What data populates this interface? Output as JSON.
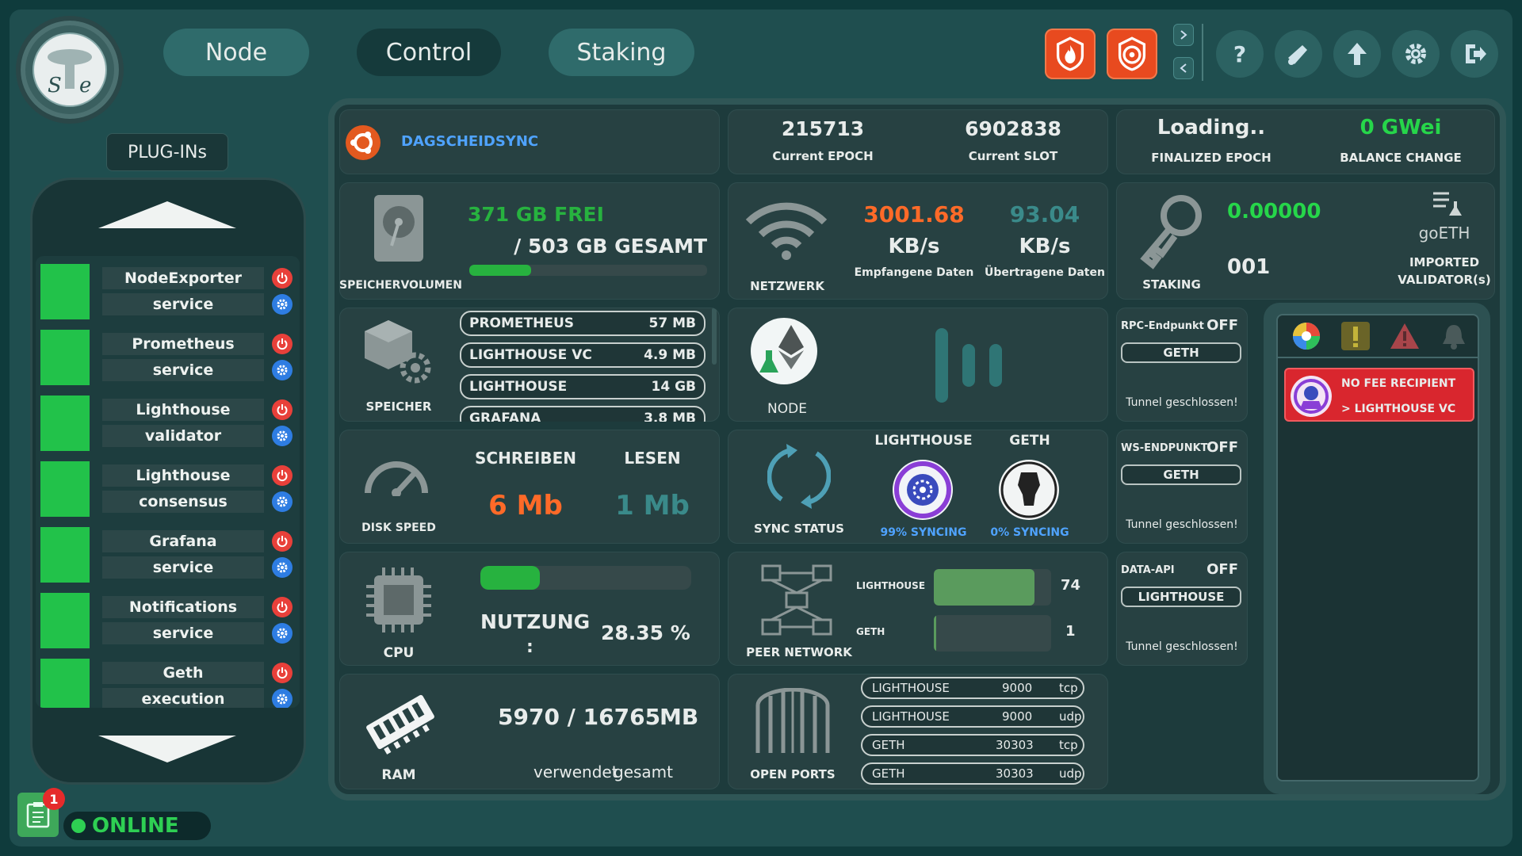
{
  "nav": {
    "tabs": [
      {
        "label": "Node"
      },
      {
        "label": "Control"
      },
      {
        "label": "Staking"
      }
    ]
  },
  "sidebar": {
    "title": "PLUG-INs",
    "plugins": [
      {
        "name": "NodeExporter",
        "type": "service"
      },
      {
        "name": "Prometheus",
        "type": "service"
      },
      {
        "name": "Lighthouse",
        "type": "validator"
      },
      {
        "name": "Lighthouse",
        "type": "consensus"
      },
      {
        "name": "Grafana",
        "type": "service"
      },
      {
        "name": "Notifications",
        "type": "service"
      },
      {
        "name": "Geth",
        "type": "execution"
      }
    ]
  },
  "status": {
    "online_label": "ONLINE",
    "notification_count": "1"
  },
  "header": {
    "node_name": "DAGSCHEIDSYNC",
    "epoch_value": "215713",
    "epoch_label": "Current EPOCH",
    "slot_value": "6902838",
    "slot_label": "Current SLOT",
    "finalized_value": "Loading..",
    "finalized_label": "FINALIZED EPOCH",
    "balance_value": "0 GWei",
    "balance_label": "BALANCE CHANGE"
  },
  "storage_volume": {
    "free": "371 GB FREI",
    "total": "/ 503 GB GESAMT",
    "label": "SPEICHERVOLUMEN",
    "used_fraction": 0.26
  },
  "network": {
    "label": "NETZWERK",
    "received_value": "3001.68",
    "received_unit": "KB/s",
    "received_label": "Empfangene Daten",
    "sent_value": "93.04",
    "sent_unit": "KB/s",
    "sent_label": "Übertragene Daten"
  },
  "staking": {
    "label": "STAKING",
    "balance": "0.00000",
    "currency": "goETH",
    "validators": "001",
    "validators_label_1": "IMPORTED",
    "validators_label_2": "VALIDATOR(s)"
  },
  "storage": {
    "label": "SPEICHER",
    "items": [
      {
        "name": "PROMETHEUS",
        "size": "57 MB"
      },
      {
        "name": "LIGHTHOUSE VC",
        "size": "4.9 MB"
      },
      {
        "name": "LIGHTHOUSE",
        "size": "14 GB"
      },
      {
        "name": "GRAFANA",
        "size": "3.8 MB"
      }
    ]
  },
  "node": {
    "label": "NODE"
  },
  "disk_speed": {
    "label": "DISK SPEED",
    "write_label": "SCHREIBEN",
    "write_value": "6 Mb",
    "read_label": "LESEN",
    "read_value": "1 Mb"
  },
  "sync": {
    "label": "SYNC STATUS",
    "client1_name": "LIGHTHOUSE",
    "client1_status": "99% SYNCING",
    "client2_name": "GETH",
    "client2_status": "0% SYNCING"
  },
  "cpu": {
    "label": "CPU",
    "usage_label": "NUTZUNG",
    "colon": ":",
    "usage_value": "28.35 %",
    "usage_fraction": 0.2835
  },
  "peers": {
    "label": "PEER NETWORK",
    "client1_name": "LIGHTHOUSE",
    "client1_count": "74",
    "client1_fraction": 0.86,
    "client2_name": "GETH",
    "client2_count": "1",
    "client2_fraction": 0.02
  },
  "ram": {
    "label": "RAM",
    "value": "5970 / 16765",
    "unit": "MB",
    "used_label": "verwendet",
    "total_label": "gesamt"
  },
  "ports": {
    "label": "OPEN PORTS",
    "items": [
      {
        "client": "LIGHTHOUSE",
        "port": "9000",
        "proto": "tcp"
      },
      {
        "client": "LIGHTHOUSE",
        "port": "9000",
        "proto": "udp"
      },
      {
        "client": "GETH",
        "port": "30303",
        "proto": "tcp"
      },
      {
        "client": "GETH",
        "port": "30303",
        "proto": "udp"
      }
    ]
  },
  "tunnels": [
    {
      "title": "RPC-Endpunkt",
      "state": "OFF",
      "client": "GETH",
      "status": "Tunnel geschlossen!"
    },
    {
      "title": "WS-ENDPUNKT",
      "state": "OFF",
      "client": "GETH",
      "status": "Tunnel geschlossen!"
    },
    {
      "title": "DATA-API",
      "state": "OFF",
      "client": "LIGHTHOUSE",
      "status": "Tunnel geschlossen!"
    }
  ],
  "alerts": {
    "item_line1": "NO FEE RECIPIENT",
    "item_line2": "> LIGHTHOUSE VC"
  },
  "colors": {
    "accent_green": "#27b23f",
    "online_green": "#2ed053",
    "received_orange": "#ff6a28",
    "sent_teal": "#3a8a8a",
    "alert_red": "#d9262e",
    "node_blue": "#4fa3ff",
    "value_green": "#26d64a"
  }
}
